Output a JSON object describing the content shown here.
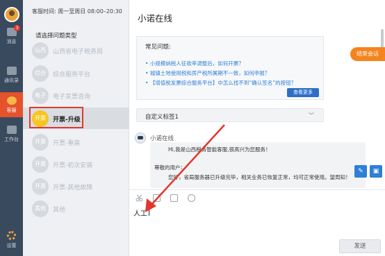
{
  "rail": {
    "items": [
      {
        "label": "消息",
        "badge": "3"
      },
      {
        "label": "通讯录"
      },
      {
        "label": "客服"
      },
      {
        "label": "工作台"
      }
    ],
    "settings_label": "设置"
  },
  "panel": {
    "hours": "客服时间: 周一至周日 08:00–20:30",
    "choose_label": "请选择问题类型",
    "categories": [
      {
        "badge": "山西",
        "label": "山西省电子税务局"
      },
      {
        "badge": "综合",
        "label": "综合服务平台"
      },
      {
        "badge": "电子",
        "label": "电子发票咨询"
      },
      {
        "badge": "开票",
        "label": "开票-升级"
      },
      {
        "badge": "开票",
        "label": "开票-重装"
      },
      {
        "badge": "开票",
        "label": "开票-初次安装"
      },
      {
        "badge": "开票",
        "label": "开票-其他故障"
      },
      {
        "badge": "其他",
        "label": "其他"
      }
    ]
  },
  "chat": {
    "title": "小诺在线",
    "end_session": "结束会话",
    "faq": {
      "title": "常见问题:",
      "questions": [
        "• 小规模纳税人征收率调整后，如何开票？",
        "• 城镇土地使用税和房产税所属期不一致，如何申报？",
        "• 【增值税发票综合服务平台】中怎么找不到“确认签名”的按钮？"
      ],
      "more": "查看更多"
    },
    "tag": {
      "label": "自定义标签1",
      "chevron": "﹀"
    },
    "bot_name": "小诺在线",
    "message": {
      "line1": "Hi,我是山西税务智能客服,很高兴为您服务！",
      "line2": "尊敬的用户：",
      "line3": "您好，省局服务器已升级完毕，相关业务已恢复正常，均可正常使用。望周知！"
    },
    "side_icons": {
      "edit": "✎",
      "image": "▣"
    },
    "compose": {
      "text": "人工",
      "send": "发送"
    }
  },
  "colors": {
    "rail_bg": "#3a4a5e",
    "accent_orange": "#f4841e",
    "link_blue": "#2f7fd6",
    "highlight_red": "#e2362d",
    "selected_badge": "#f7c51f"
  }
}
